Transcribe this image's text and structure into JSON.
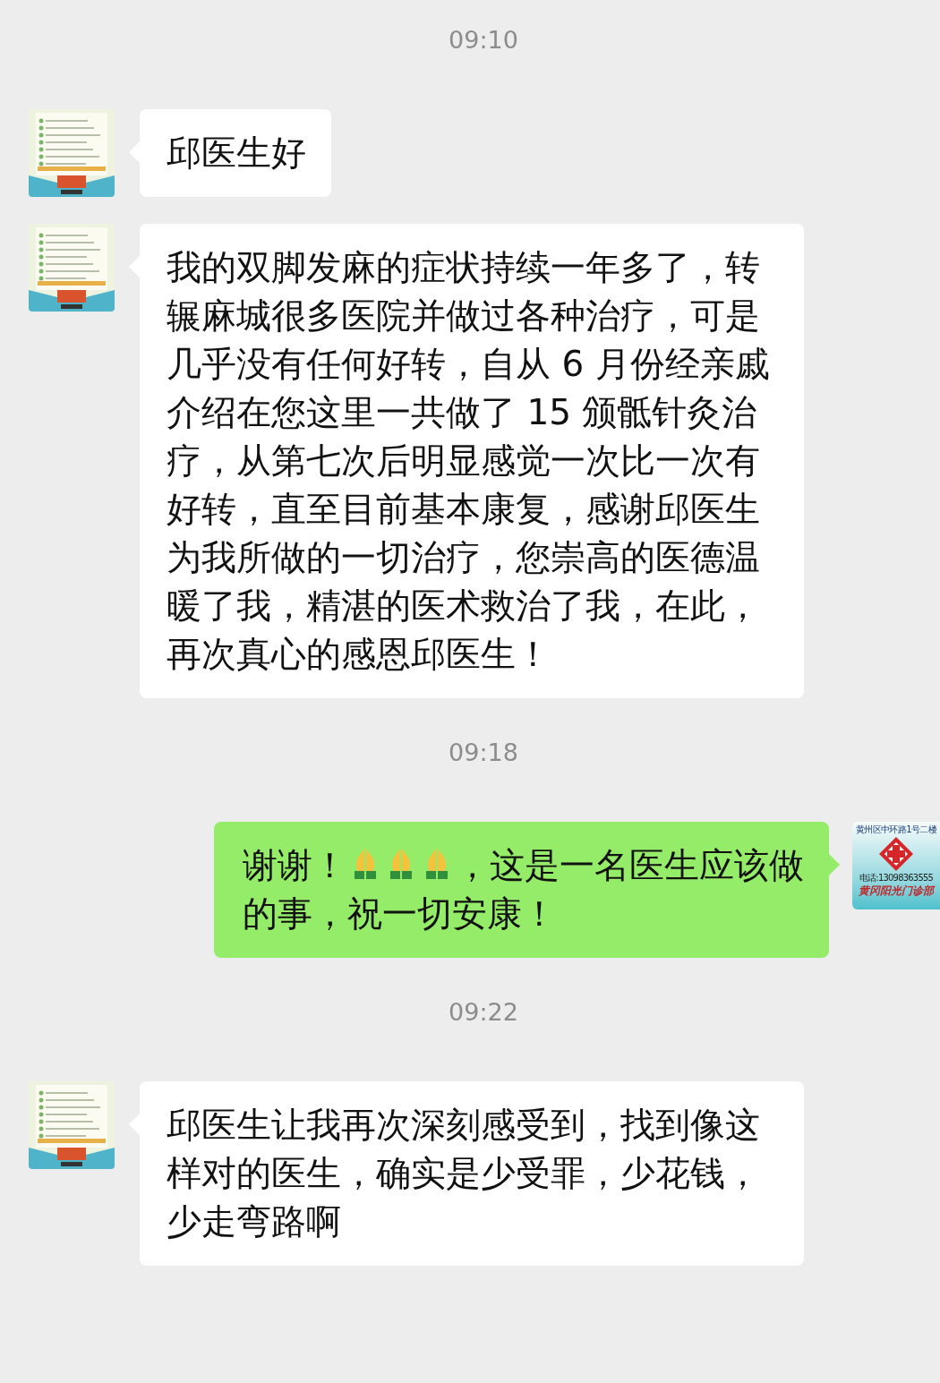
{
  "chat": [
    {
      "kind": "time",
      "text": "09:10"
    },
    {
      "kind": "incoming",
      "lines": [
        [
          {
            "kind": "text",
            "text": "邱医生好"
          }
        ]
      ]
    },
    {
      "kind": "incoming",
      "lines": [
        [
          {
            "kind": "text",
            "text": "我的双脚发麻的症状持续一年多了，转辗麻城很多医院并做过各种治疗，可是几乎没有任何好转，自从 6 月份经亲戚介绍在您这里一共做了 15 颁骶针灸治疗，从第七次后明显感觉一次比一次有好转，直至目前基本康复，感谢邱医生为我所做的一切治疗，您崇高的医德温暖了我，精湛的医术救治了我，在此，再次真心的感恩邱医生！"
          }
        ]
      ]
    },
    {
      "kind": "time",
      "text": "09:18"
    },
    {
      "kind": "outgoing",
      "lines": [
        [
          {
            "kind": "text",
            "text": "谢谢！"
          },
          {
            "kind": "emoji"
          },
          {
            "kind": "emoji"
          },
          {
            "kind": "emoji"
          },
          {
            "kind": "text",
            "text": "，这是一名医生应该做"
          }
        ],
        [
          {
            "kind": "text",
            "text": "的事，祝一切安康！"
          }
        ]
      ]
    },
    {
      "kind": "time",
      "text": "09:22"
    },
    {
      "kind": "incoming",
      "lines": [
        [
          {
            "kind": "text",
            "text": "邱医生让我再次深刻感受到，找到像这样对的医生，确实是少受罪，少花钱，少走弯路啊"
          }
        ]
      ]
    }
  ],
  "self_avatar": {
    "address": "黄州区中环路1号二楼",
    "phone": "电话:13098363555",
    "clinic": "黄冈阳光门诊部"
  }
}
